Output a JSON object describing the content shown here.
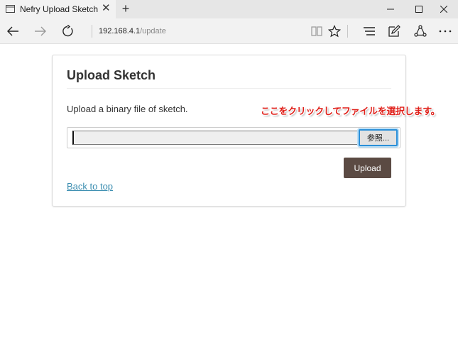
{
  "browser": {
    "tab_title": "Nefry Upload Sketch",
    "tab_close": "✕",
    "new_tab": "+",
    "address_host": "192.168.4.1",
    "address_path": "/update",
    "window_controls": {
      "minimize": "—",
      "maximize": "☐",
      "close": "✕"
    },
    "icons": [
      "back-icon",
      "forward-icon",
      "refresh-icon",
      "reading-view-icon",
      "favorite-star-icon",
      "hub-icon",
      "web-note-icon",
      "share-icon",
      "more-icon"
    ]
  },
  "page": {
    "title": "Upload Sketch",
    "description": "Upload a binary file of sketch.",
    "file_input_value": "",
    "browse_label": "参照...",
    "upload_label": "Upload",
    "back_link": "Back to top"
  },
  "annotation": {
    "text": "ここをクリックしてファイルを選択します。",
    "color": "#e0201a"
  },
  "colors": {
    "upload_button": "#5b4a43",
    "link": "#3a8db0",
    "focus_ring": "#2b8fd8"
  }
}
